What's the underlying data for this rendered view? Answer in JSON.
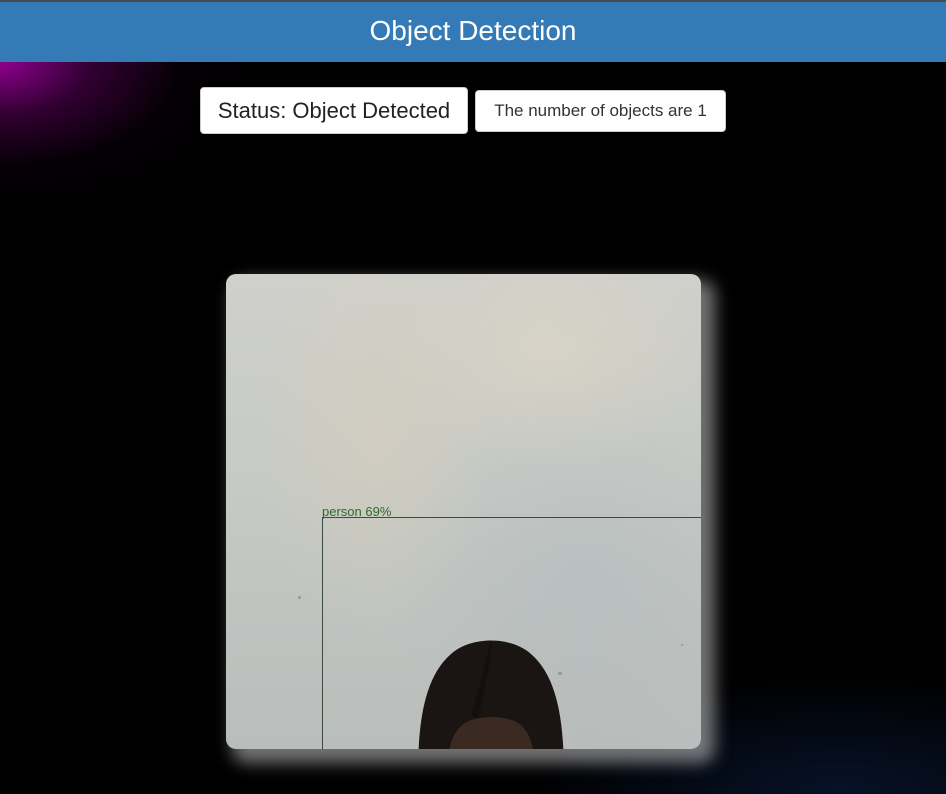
{
  "header": {
    "title": "Object Detection"
  },
  "status": {
    "text": "Status: Object Detected",
    "count_text": "The number of objects are 1"
  },
  "video": {
    "detections": [
      {
        "label": "person 69%"
      }
    ]
  },
  "colors": {
    "navbar": "#337ab7",
    "background": "#000000",
    "glow": "#960096",
    "box_stroke": "#3c4b3c",
    "label_text": "#2d6b2d"
  }
}
